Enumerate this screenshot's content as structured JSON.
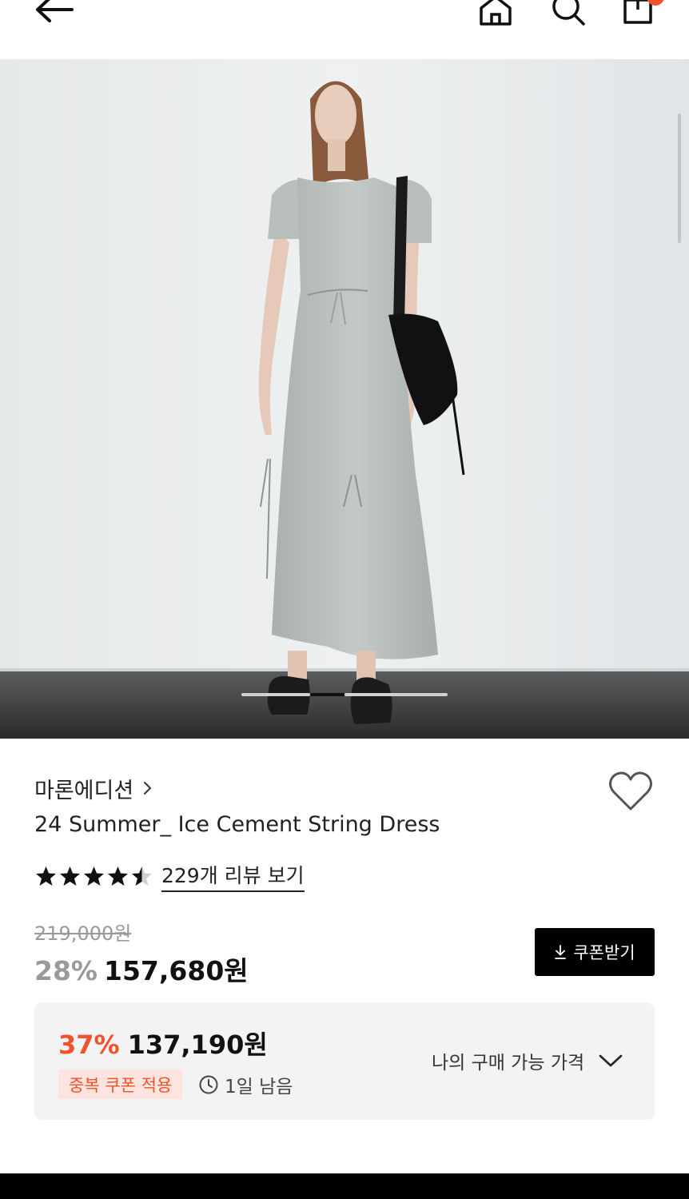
{
  "header": {
    "icons": [
      "back-arrow-icon",
      "home-icon",
      "search-icon",
      "cart-icon"
    ],
    "accent_badge_color": "#f1512b"
  },
  "gallery": {
    "image": "model wearing light grey short-sleeve string dress with black shoulder bag against white wall",
    "pager_active_color": "#111111",
    "pager_inactive_color": "#d0d0d0"
  },
  "product": {
    "brand": "마론에디션",
    "title": "24 Summer_ Ice Cement String Dress",
    "rating": 4.5,
    "review_link": "229개 리뷰 보기",
    "original_price": "219,000원",
    "discount_rate": "28%",
    "sale_price": "157,680원"
  },
  "coupon_button": {
    "label": "쿠폰받기"
  },
  "best_price": {
    "discount_rate": "37%",
    "price": "137,190원",
    "badge": "중복 쿠폰 적용",
    "time_left": "1일 남음",
    "my_price_label": "나의 구매 가능 가격"
  },
  "colors": {
    "accent": "#f1512b",
    "accent_bg": "#fde4de",
    "box_bg": "#f3f3f3"
  }
}
